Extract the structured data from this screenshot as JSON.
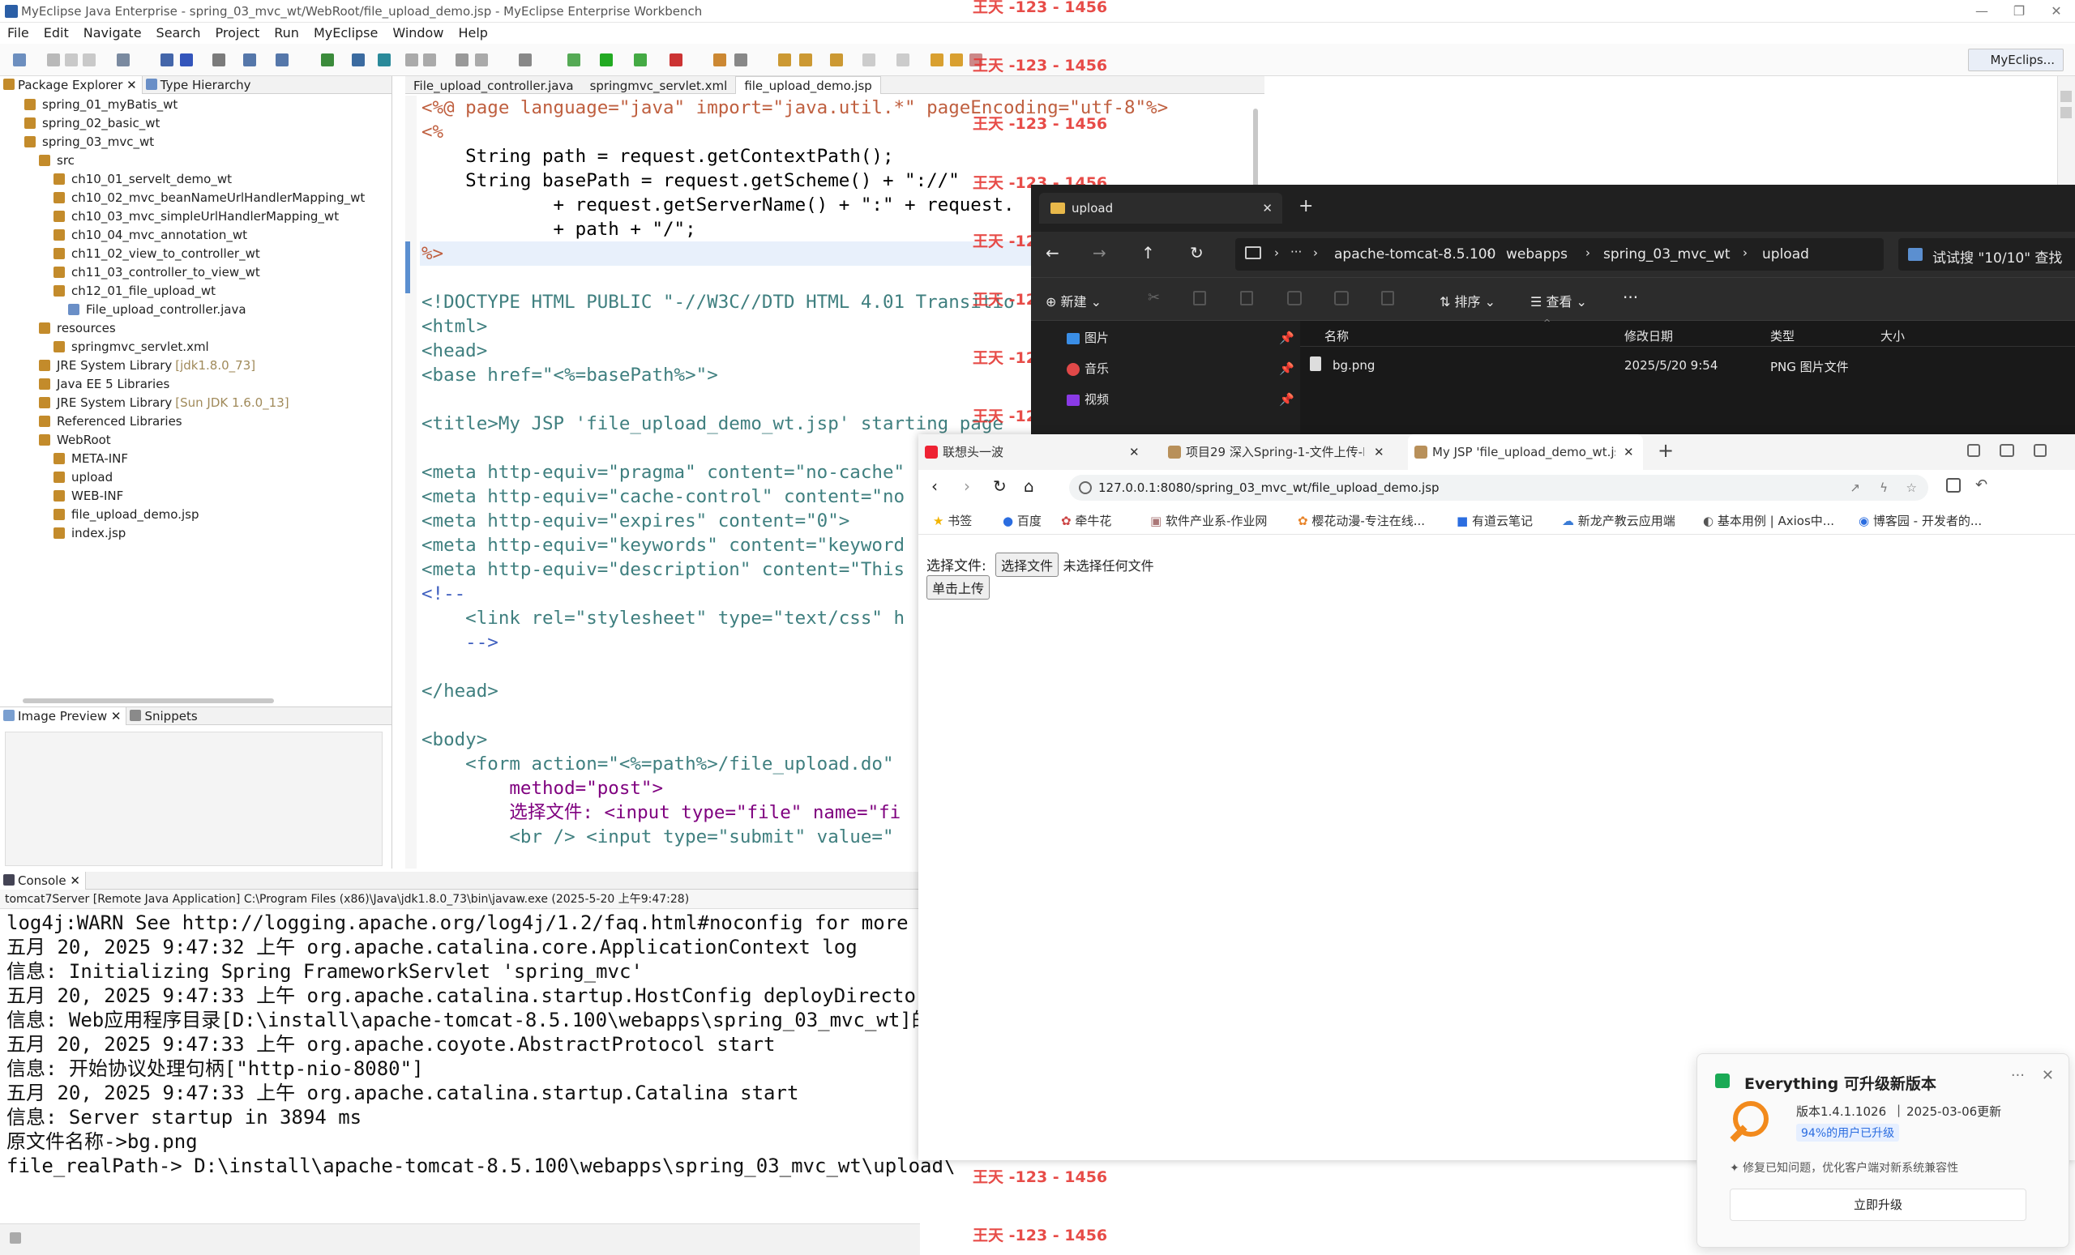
{
  "window": {
    "title": "MyEclipse Java Enterprise - spring_03_mvc_wt/WebRoot/file_upload_demo.jsp - MyEclipse Enterprise Workbench"
  },
  "menu": [
    "File",
    "Edit",
    "Navigate",
    "Search",
    "Project",
    "Run",
    "MyEclipse",
    "Window",
    "Help"
  ],
  "perspective": "MyEclips...",
  "package_explorer": {
    "tab_label": "Package Explorer",
    "tab2_label": "Type Hierarchy",
    "items": [
      {
        "label": "spring_01_myBatis_wt",
        "indent": 1
      },
      {
        "label": "spring_02_basic_wt",
        "indent": 1
      },
      {
        "label": "spring_03_mvc_wt",
        "indent": 1
      },
      {
        "label": "src",
        "indent": 2
      },
      {
        "label": "ch10_01_servelt_demo_wt",
        "indent": 3
      },
      {
        "label": "ch10_02_mvc_beanNameUrlHandlerMapping_wt",
        "indent": 3
      },
      {
        "label": "ch10_03_mvc_simpleUrlHandlerMapping_wt",
        "indent": 3
      },
      {
        "label": "ch10_04_mvc_annotation_wt",
        "indent": 3
      },
      {
        "label": "ch11_02_view_to_controller_wt",
        "indent": 3
      },
      {
        "label": "ch11_03_controller_to_view_wt",
        "indent": 3
      },
      {
        "label": "ch12_01_file_upload_wt",
        "indent": 3
      },
      {
        "label": "File_upload_controller.java",
        "indent": 4
      },
      {
        "label": "resources",
        "indent": 2
      },
      {
        "label": "springmvc_servlet.xml",
        "indent": 3
      },
      {
        "label": "JRE System Library",
        "suffix": "[jdk1.8.0_73]",
        "indent": 2
      },
      {
        "label": "Java EE 5 Libraries",
        "indent": 2
      },
      {
        "label": "JRE System Library",
        "suffix": "[Sun JDK 1.6.0_13]",
        "indent": 2
      },
      {
        "label": "Referenced Libraries",
        "indent": 2
      },
      {
        "label": "WebRoot",
        "indent": 2
      },
      {
        "label": "META-INF",
        "indent": 3
      },
      {
        "label": "upload",
        "indent": 3
      },
      {
        "label": "WEB-INF",
        "indent": 3
      },
      {
        "label": "file_upload_demo.jsp",
        "indent": 3
      },
      {
        "label": "index.jsp",
        "indent": 3
      }
    ]
  },
  "image_preview": {
    "tab_label": "Image Preview",
    "tab2_label": "Snippets"
  },
  "editor": {
    "tabs": [
      "File_upload_controller.java",
      "springmvc_servlet.xml",
      "file_upload_demo.jsp"
    ],
    "lines": [
      "<%@ page language=\"java\" import=\"java.util.*\" pageEncoding=\"utf-8\"%>",
      "<%",
      "    String path = request.getContextPath();",
      "    String basePath = request.getScheme() + \"://\"",
      "            + request.getServerName() + \":\" + request.",
      "            + path + \"/\";",
      "%>",
      "",
      "<!DOCTYPE HTML PUBLIC \"-//W3C//DTD HTML 4.01 Transitio",
      "<html>",
      "<head>",
      "<base href=\"<%=basePath%>\">",
      "",
      "<title>My JSP 'file_upload_demo_wt.jsp' starting page",
      "",
      "<meta http-equiv=\"pragma\" content=\"no-cache\"",
      "<meta http-equiv=\"cache-control\" content=\"no",
      "<meta http-equiv=\"expires\" content=\"0\">",
      "<meta http-equiv=\"keywords\" content=\"keyword",
      "<meta http-equiv=\"description\" content=\"This",
      "<!--",
      "    <link rel=\"stylesheet\" type=\"text/css\" h",
      "    -->",
      "",
      "</head>",
      "",
      "<body>",
      "    <form action=\"<%=path%>/file_upload.do\"",
      "        method=\"post\">",
      "        选择文件: <input type=\"file\" name=\"fi",
      "        <br /> <input type=\"submit\" value=\""
    ]
  },
  "console": {
    "tab_label": "Console",
    "header": "tomcat7Server [Remote Java Application] C:\\Program Files (x86)\\Java\\jdk1.8.0_73\\bin\\javaw.exe (2025-5-20 上午9:47:28)",
    "lines": [
      "log4j:WARN See http://logging.apache.org/log4j/1.2/faq.html#noconfig for more in",
      "五月 20, 2025 9:47:32 上午 org.apache.catalina.core.ApplicationContext log",
      "信息: Initializing Spring FrameworkServlet 'spring_mvc'",
      "五月 20, 2025 9:47:33 上午 org.apache.catalina.startup.HostConfig deployDirectory",
      "信息: Web应用程序目录[D:\\install\\apache-tomcat-8.5.100\\webapps\\spring_03_mvc_wt]的",
      "五月 20, 2025 9:47:33 上午 org.apache.coyote.AbstractProtocol start",
      "信息: 开始协议处理句柄[\"http-nio-8080\"]",
      "五月 20, 2025 9:47:33 上午 org.apache.catalina.startup.Catalina start",
      "信息: Server startup in 3894 ms",
      "原文件名称->bg.png",
      "file_realPath-> D:\\install\\apache-tomcat-8.5.100\\webapps\\spring_03_mvc_wt\\upload\\"
    ]
  },
  "file_explorer": {
    "tab_title": "upload",
    "breadcrumb": [
      "apache-tomcat-8.5.100",
      "webapps",
      "spring_03_mvc_wt",
      "upload"
    ],
    "search_placeholder": "试试搜 \"10/10\" 查找",
    "new_label": "新建",
    "sort_label": "排序",
    "view_label": "查看",
    "nav_items": [
      "图片",
      "音乐",
      "视频"
    ],
    "columns": [
      "名称",
      "修改日期",
      "类型",
      "大小"
    ],
    "files": [
      {
        "name": "bg.png",
        "date": "2025/5/20 9:54",
        "type": "PNG 图片文件"
      }
    ]
  },
  "browser": {
    "tabs": [
      "联想头一波",
      "项目29 深入Spring-1-文件上传-I",
      "My JSP 'file_upload_demo_wt.js"
    ],
    "url": "127.0.0.1:8080/spring_03_mvc_wt/file_upload_demo.jsp",
    "bookmarks": [
      "书签",
      "百度",
      "牵牛花",
      "软件产业系-作业网",
      "樱花动漫-专注在线...",
      "有道云笔记",
      "新龙产教云应用端",
      "基本用例 | Axios中...",
      "博客园 - 开发者的..."
    ],
    "page": {
      "label": "选择文件:",
      "choose_button": "选择文件",
      "no_file": "未选择任何文件",
      "submit_button": "单击上传"
    }
  },
  "notification": {
    "title": "Everything 可升级新版本",
    "version": "版本1.4.1.1026",
    "date": "2025-03-06更新",
    "badge": "94%的用户已升级",
    "desc": "✦ 修复已知问题，优化客户端对新系统兼容性",
    "button": "立即升级"
  },
  "watermark": "王天 -123 - 1456"
}
